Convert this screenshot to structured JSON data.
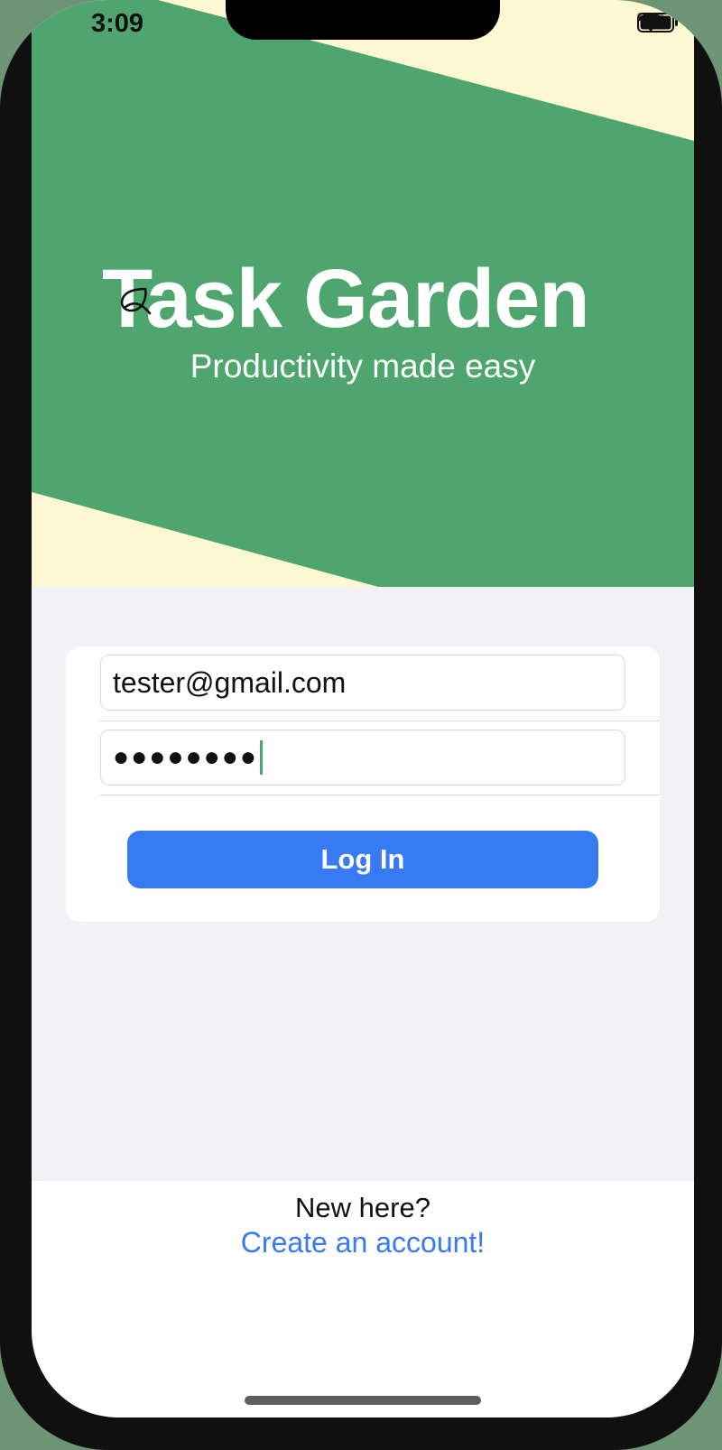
{
  "status_bar": {
    "time": "3:09",
    "icons": [
      "cellular-dots-icon",
      "wifi-icon",
      "battery-icon"
    ]
  },
  "hero": {
    "title": "Task Garden",
    "subtitle": "Productivity made easy",
    "icon": "leaf-icon",
    "colors": {
      "green": "#4ea56d",
      "cream": "#fdf8d2"
    }
  },
  "login_form": {
    "email_value": "tester@gmail.com",
    "password_value": "●●●●●●●●",
    "login_label": "Log In",
    "accent": "#377af4"
  },
  "footer": {
    "question": "New here?",
    "create_account_label": "Create an account!"
  }
}
